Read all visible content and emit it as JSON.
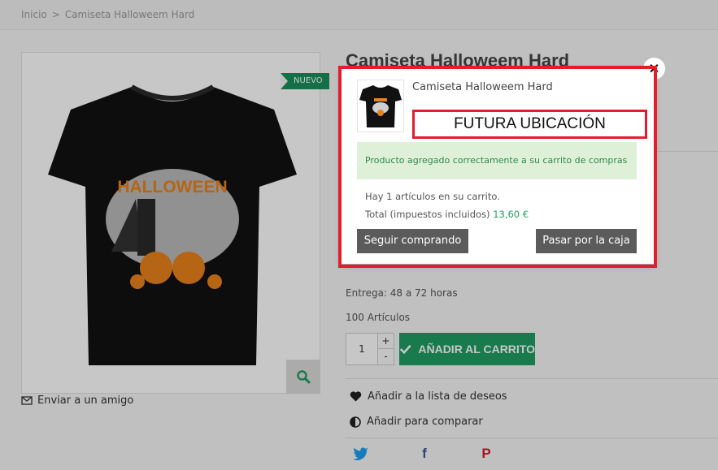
{
  "breadcrumb": {
    "home": "Inicio",
    "separator": ">",
    "current": "Camiseta Halloweem Hard"
  },
  "product": {
    "title": "Camiseta Halloweem Hard",
    "badge": "NUEVO",
    "delivery": "Entrega: 48 a 72 horas",
    "stock": "100 Artículos",
    "quantity": "1",
    "add_to_cart": "AÑADIR AL CARRITO",
    "shirt_print": "HALLOWEEN"
  },
  "actions": {
    "send_friend": "Enviar a un amigo",
    "wishlist": "Añadir a la lista de deseos",
    "compare": "Añadir para comparar"
  },
  "modal": {
    "product_name": "Camiseta Halloweem Hard",
    "placeholder_label": "FUTURA UBICACIÓN",
    "success": "Producto agregado correctamente a su carrito de compras",
    "cart_count": "Hay 1 artículos en su carrito.",
    "total_label": "Total (impuestos incluidos)",
    "total_value": "13,60 €",
    "continue_label": "Seguir comprando",
    "checkout_label": "Pasar por la caja"
  },
  "icons": {
    "zoom": "search-icon",
    "send_friend": "envelope-icon",
    "wishlist": "heart-icon",
    "compare": "half-circle-icon",
    "close": "close-icon",
    "twitter": "twitter-icon",
    "facebook": "facebook-icon",
    "pinterest": "pinterest-icon"
  },
  "colors": {
    "accent_green": "#1f9d63",
    "highlight_red": "#e51b2e",
    "button_gray": "#5b5b5b",
    "success_bg": "#dff0d8"
  }
}
